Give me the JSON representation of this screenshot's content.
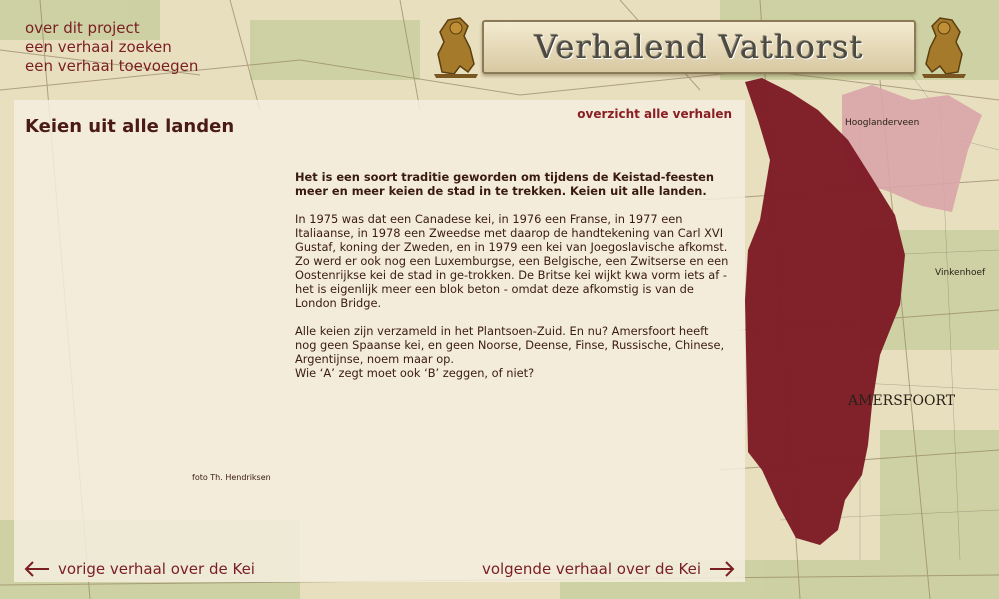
{
  "site": {
    "title": "Verhalend Vathorst"
  },
  "nav": {
    "items": [
      {
        "label": "over dit project"
      },
      {
        "label": "een verhaal zoeken"
      },
      {
        "label": "een verhaal toevoegen"
      }
    ]
  },
  "story": {
    "title": "Keien uit alle landen",
    "overview_link": "overzicht alle verhalen",
    "intro": "Het is een soort traditie geworden om tijdens de Keistad-feesten meer en meer keien de stad in te trekken. Keien uit alle landen.",
    "body1": "In 1975 was dat een Canadese kei, in 1976 een Franse, in 1977 een Italiaanse, in 1978 een Zweedse met daarop de handtekening van Carl XVI Gustaf, koning der Zweden, en in 1979 een kei van Joegoslavische afkomst. Zo werd er ook nog een Luxemburgse, een Belgische, een Zwitserse en een Oostenrijkse kei de stad in ge-trokken. De Britse kei wijkt kwa vorm iets af - het is eigenlijk meer een blok beton - omdat deze afkomstig is van de London Bridge.",
    "body2": "Alle keien zijn verzameld in het Plantsoen-Zuid. En nu? Amersfoort heeft nog geen Spaanse kei, en geen Noorse, Deense, Finse, Russische, Chinese, Argentijnse, noem maar op.\nWie ‘A’ zegt moet ook ‘B’ zeggen, of niet?",
    "photo_credit": "foto Th. Hendriksen",
    "prev_label": "vorige verhaal over de Kei",
    "next_label": "volgende verhaal over de Kei"
  },
  "map_labels": {
    "hooglanderveen": "Hooglanderveen",
    "vinkenhoef": "Vinkenhoef",
    "amersfoort": "AMERSFOORT"
  },
  "colors": {
    "accent": "#7a1e22",
    "region_dark": "#7d1a24",
    "region_light": "#d9a4a8"
  }
}
